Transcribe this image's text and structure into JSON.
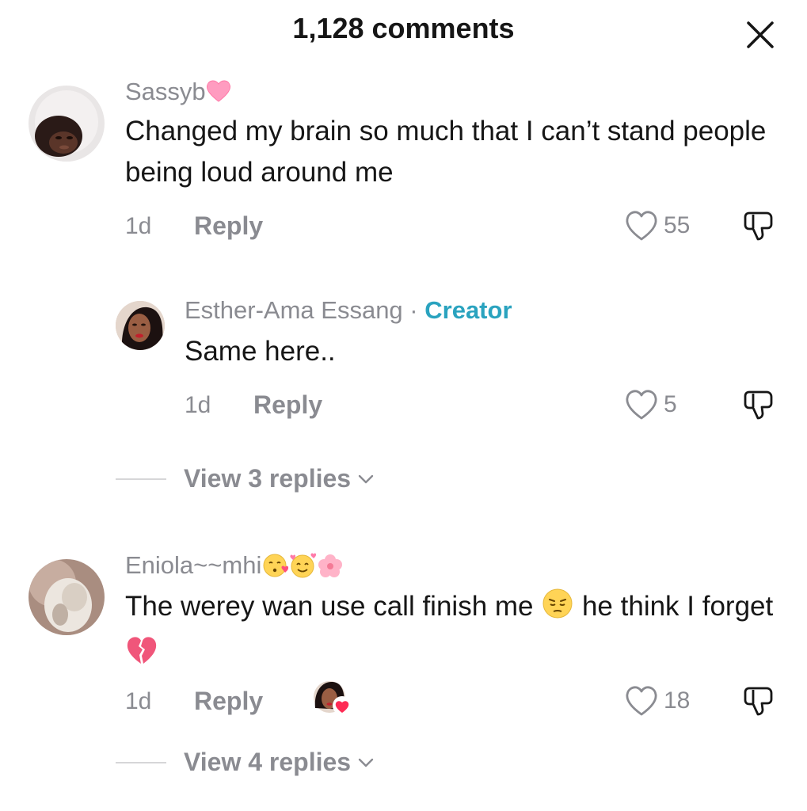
{
  "header": {
    "title": "1,128 comments",
    "close_icon": "close-icon"
  },
  "comments": [
    {
      "username": "Sassyb",
      "username_emoji": "pink-heart-emoji",
      "text": "Changed my brain so much that I can’t stand people being loud around me",
      "time": "1d",
      "reply_label": "Reply",
      "likes": "55",
      "reply": {
        "username": "Esther-Ama Essang",
        "separator": "·",
        "badge": "Creator",
        "text": "Same here..",
        "time": "1d",
        "reply_label": "Reply",
        "likes": "5"
      },
      "view_replies": "View 3 replies"
    },
    {
      "username": "Eniola~~mhi",
      "username_emojis": [
        "kissing-face-emoji",
        "smiling-face-with-hearts-emoji",
        "hibiscus-emoji"
      ],
      "text_part1": "The werey wan use call finish me",
      "text_emoji1": "pensive-face-emoji",
      "text_part2": "he think I forget",
      "text_emoji2": "broken-heart-emoji",
      "time": "1d",
      "reply_label": "Reply",
      "liked_by_creator": true,
      "likes": "18",
      "view_replies": "View 4 replies"
    }
  ],
  "colors": {
    "text": "#161616",
    "muted": "#8a8b91",
    "creator": "#2aa3bf",
    "heart_pink": "#ff7aa8",
    "like_red": "#fe2c55"
  }
}
